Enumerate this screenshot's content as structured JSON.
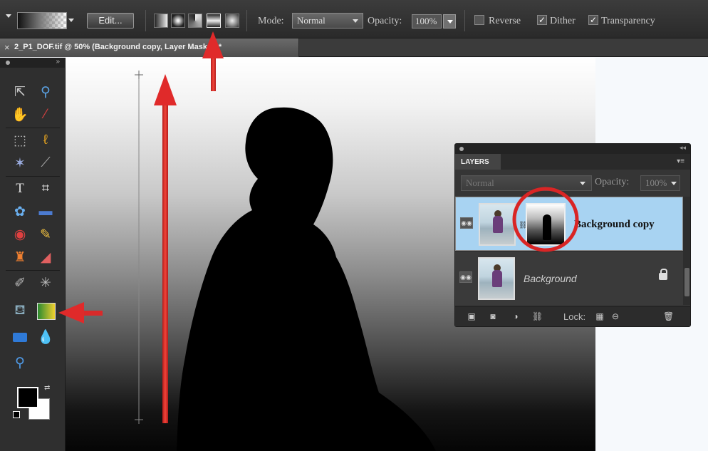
{
  "options_bar": {
    "edit_label": "Edit...",
    "mode_label": "Mode:",
    "mode_value": "Normal",
    "opacity_label": "Opacity:",
    "opacity_value": "100%",
    "reverse_label": "Reverse",
    "dither_label": "Dither",
    "transparency_label": "Transparency",
    "reverse_checked": false,
    "dither_checked": true,
    "transparency_checked": true,
    "gradient_types": [
      "linear-gradient-icon",
      "radial-gradient-icon",
      "angle-gradient-icon",
      "reflected-gradient-icon",
      "diamond-gradient-icon"
    ],
    "selected_gradient_type": "reflected-gradient-icon"
  },
  "document": {
    "tab_title": "2_P1_DOF.tif @ 50% (Background copy, Layer Mask/8) *",
    "close_glyph": "×"
  },
  "toolbox": {
    "tools": [
      "move-tool-icon",
      "zoom-tool-icon",
      "hand-tool-icon",
      "eyedropper-tool-icon",
      "marquee-tool-icon",
      "lasso-tool-icon",
      "magic-wand-tool-icon",
      "quick-selection-tool-icon",
      "type-tool-icon",
      "crop-tool-icon",
      "custom-shape-tool-icon",
      "recompose-tool-icon",
      "red-eye-tool-icon",
      "healing-brush-tool-icon",
      "clone-stamp-tool-icon",
      "eraser-tool-icon",
      "brush-tool-icon",
      "smart-brush-tool-icon",
      "paint-bucket-tool-icon",
      "gradient-tool-icon",
      "rectangle-shape-tool-icon",
      "blur-tool-icon",
      "sponge-tool-icon"
    ],
    "active_tool": "gradient-tool-icon",
    "foreground_color": "#000000",
    "background_color": "#ffffff"
  },
  "layers_panel": {
    "tab_label": "LAYERS",
    "blend_mode": "Normal",
    "opacity_label": "Opacity:",
    "opacity_value": "100%",
    "layers": [
      {
        "name": "Background copy",
        "selected": true,
        "has_mask": true,
        "locked": false
      },
      {
        "name": "Background",
        "selected": false,
        "has_mask": false,
        "locked": true
      }
    ],
    "lock_label": "Lock:"
  },
  "colors": {
    "annotation_red": "#e32b2b",
    "selected_layer": "#a8d3f2",
    "panel_bg": "#353535"
  }
}
